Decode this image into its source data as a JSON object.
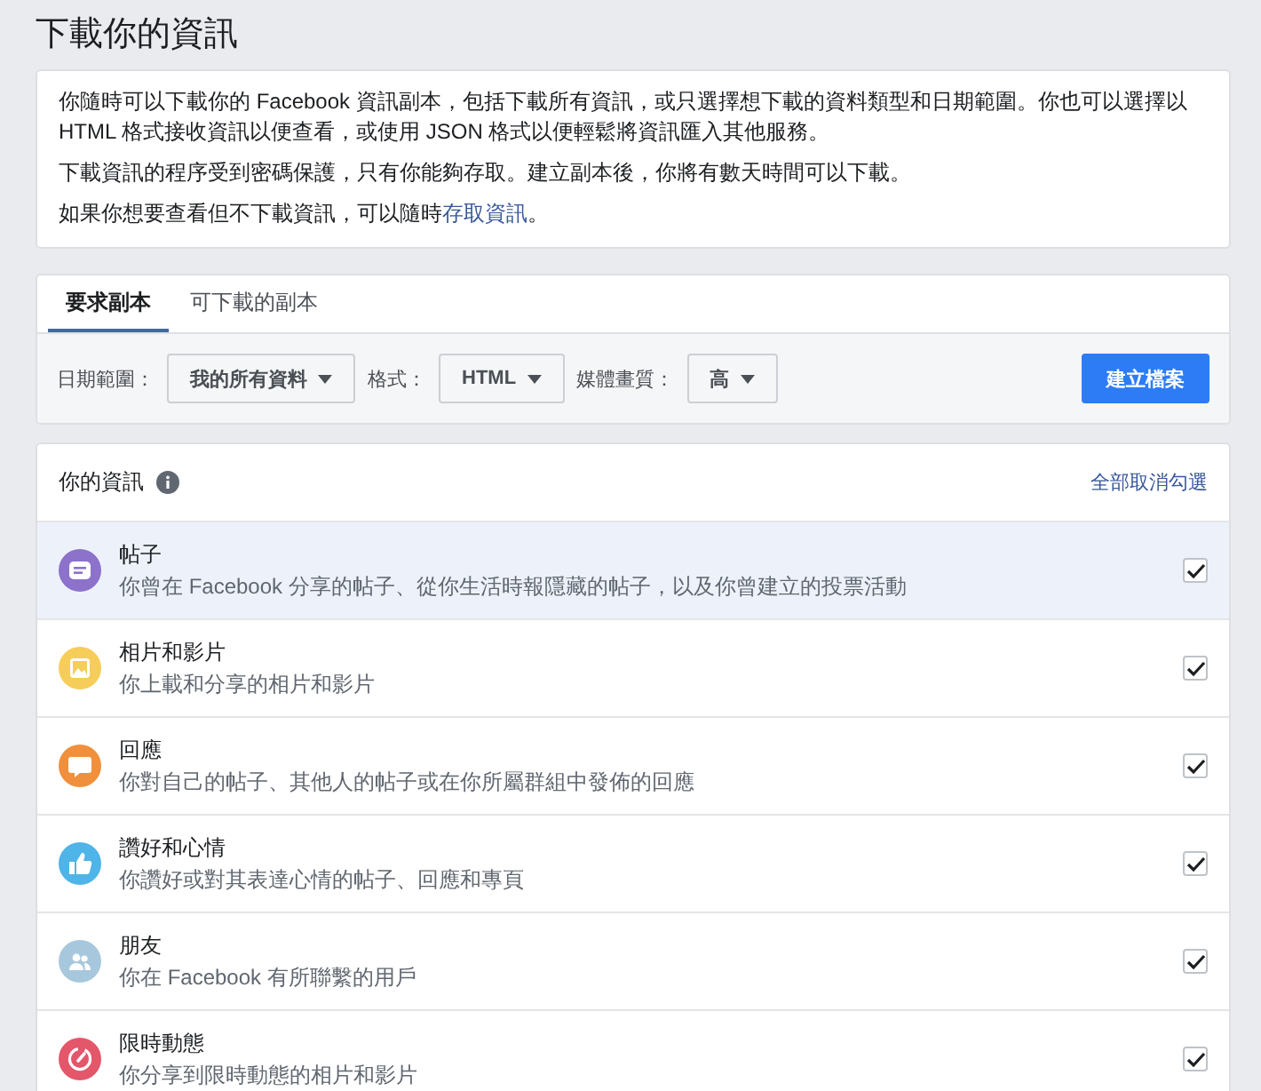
{
  "page_title": "下載你的資訊",
  "intro": {
    "paragraphs": [
      {
        "text": "你隨時可以下載你的 Facebook 資訊副本，包括下載所有資訊，或只選擇想下載的資料類型和日期範圍。你也可以選擇以 HTML 格式接收資訊以便查看，或使用 JSON 格式以便輕鬆將資訊匯入其他服務。"
      },
      {
        "text": "下載資訊的程序受到密碼保護，只有你能夠存取。建立副本後，你將有數天時間可以下載。"
      },
      {
        "text": "如果你想要查看但不下載資訊，可以隨時",
        "link": "存取資訊",
        "after": "。"
      }
    ]
  },
  "tabs": [
    {
      "label": "要求副本",
      "selected": true
    },
    {
      "label": "可下載的副本",
      "selected": false
    }
  ],
  "options": [
    {
      "label": "日期範圍：",
      "value": "我的所有資料"
    },
    {
      "label": "格式：",
      "value": "HTML"
    },
    {
      "label": "媒體畫質：",
      "value": "高"
    }
  ],
  "create_button": "建立檔案",
  "info": {
    "title": "你的資訊",
    "deselect_all": "全部取消勾選",
    "categories": [
      {
        "kind": "posts",
        "color": "#8c72cb",
        "title": "帖子",
        "description": "你曾在 Facebook 分享的帖子、從你生活時報隱藏的帖子，以及你曾建立的投票活動",
        "checked": true,
        "selected": true
      },
      {
        "kind": "photos",
        "color": "#f7cd5a",
        "title": "相片和影片",
        "description": "你上載和分享的相片和影片",
        "checked": true,
        "selected": false
      },
      {
        "kind": "comments",
        "color": "#f0903c",
        "title": "回應",
        "description": "你對自己的帖子、其他人的帖子或在你所屬群組中發佈的回應",
        "checked": true,
        "selected": false
      },
      {
        "kind": "likes",
        "color": "#4fb4e8",
        "title": "讚好和心情",
        "description": "你讚好或對其表達心情的帖子、回應和專頁",
        "checked": true,
        "selected": false
      },
      {
        "kind": "friends",
        "color": "#a7c8dc",
        "title": "朋友",
        "description": "你在 Facebook 有所聯繫的用戶",
        "checked": true,
        "selected": false
      },
      {
        "kind": "stories",
        "color": "#e4566a",
        "title": "限時動態",
        "description": "你分享到限時動態的相片和影片",
        "checked": true,
        "selected": false
      }
    ]
  }
}
